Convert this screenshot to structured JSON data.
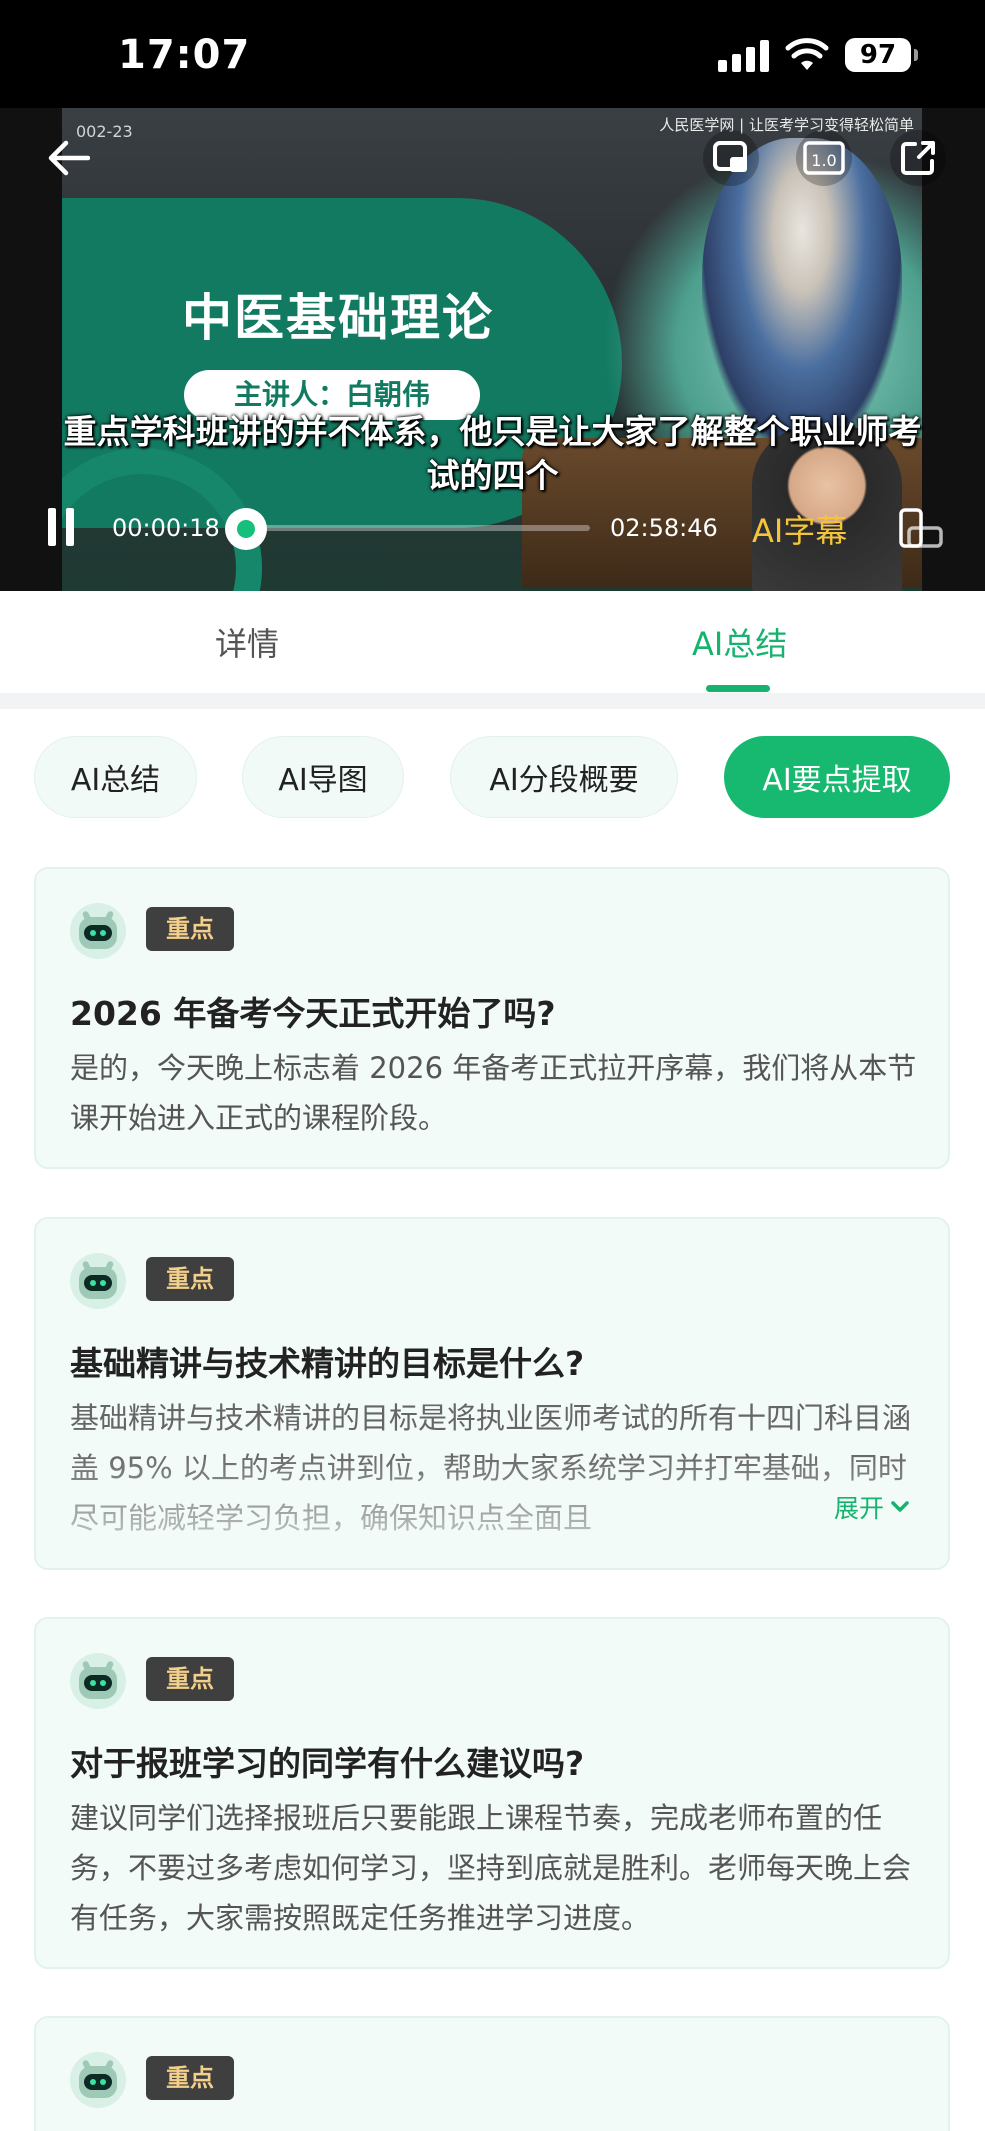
{
  "status_bar": {
    "time": "17:07",
    "battery": "97"
  },
  "video": {
    "tag": "002-23",
    "brand": "人民医学网 | 让医考学习变得轻松简单",
    "lesson_title": "中医基础理论",
    "speaker": "主讲人：白朝伟",
    "subtitle": "重点学科班讲的并不体系，他只是让大家了解整个职业师考试的四个",
    "speed_label": "1.0",
    "current_time": "00:00:18",
    "total_time": "02:58:46",
    "progress_fraction": 0.002,
    "ai_subtitle_label": "AI字幕",
    "colors": {
      "accent": "#16b96f",
      "subtitle_button": "#f5c43a"
    },
    "icons": [
      "back-arrow-icon",
      "cast-icon",
      "speed-icon",
      "share-icon",
      "pause-icon",
      "rotate-screen-icon"
    ]
  },
  "tabs": [
    {
      "label": "详情",
      "active": false
    },
    {
      "label": "AI总结",
      "active": true
    }
  ],
  "chips": [
    {
      "label": "AI总结",
      "active": false
    },
    {
      "label": "AI导图",
      "active": false
    },
    {
      "label": "AI分段概要",
      "active": false
    },
    {
      "label": "AI要点提取",
      "active": true
    }
  ],
  "cards": [
    {
      "badge": "重点",
      "question": "2026 年备考今天正式开始了吗?",
      "answer": "是的，今天晚上标志着 2026 年备考正式拉开序幕，我们将从本节课开始进入正式的课程阶段。"
    },
    {
      "badge": "重点",
      "question": "基础精讲与技术精讲的目标是什么?",
      "answer": "基础精讲与技术精讲的目标是将执业医师考试的所有十四门科目涵盖 95% 以上的考点讲到位，帮助大家系统学习并打牢基础，同时尽可能减轻学习负担，确保知识点全面且",
      "expand_label": "展开"
    },
    {
      "badge": "重点",
      "question": "对于报班学习的同学有什么建议吗?",
      "answer": "建议同学们选择报班后只要能跟上课程节奏，完成老师布置的任务，不要过多考虑如何学习，坚持到底就是胜利。老师每天晚上会有任务，大家需按照既定任务推进学习进度。"
    },
    {
      "badge": "重点"
    }
  ]
}
